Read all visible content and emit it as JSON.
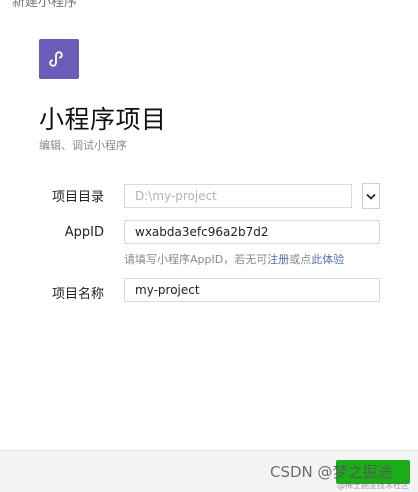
{
  "window": {
    "title": "新建小程序",
    "accent_color": "#1aad19"
  },
  "header": {
    "logo_icon": "mini-program-logo-icon",
    "logo_color": "#6b5cb8",
    "title": "小程序项目",
    "subtitle": "编辑、调试小程序"
  },
  "form": {
    "project_dir": {
      "label": "项目目录",
      "value": "",
      "placeholder": "D:\\my-project",
      "dropdown_icon": "chevron-down-icon"
    },
    "appid": {
      "label": "AppID",
      "value": "wxabda3efc96a2b7d2",
      "hint_prefix": "请填写小程序AppID，若无可",
      "hint_link_register": "注册",
      "hint_middle": "或点",
      "hint_link_trial": "此体验"
    },
    "project_name": {
      "label": "项目名称",
      "value": "my-project"
    }
  },
  "footer": {
    "watermark": "CSDN @梦之掘途",
    "watermark_small": "@稀土掘金技术社区"
  }
}
